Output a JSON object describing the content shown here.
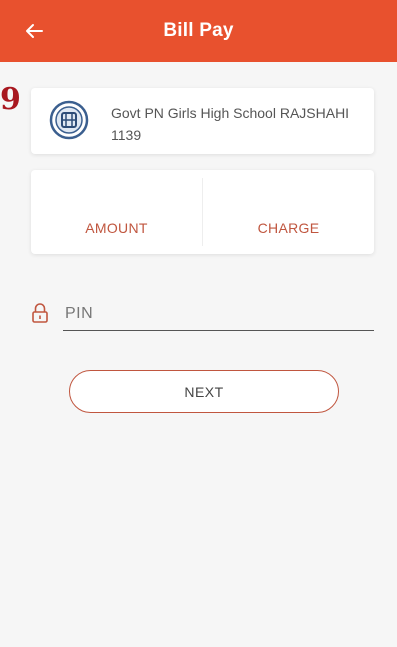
{
  "app_bar": {
    "title": "Bill Pay",
    "color": "#e8512e",
    "back_icon": "arrow-left-icon"
  },
  "corner_mark": "9",
  "school": {
    "name": "Govt PN Girls High School RAJSHAHI",
    "code": "1139",
    "logo_icon": "school-logo-icon"
  },
  "amounts": {
    "amount_label": "AMOUNT",
    "charge_label": "CHARGE",
    "label_color": "#c0563f"
  },
  "pin": {
    "placeholder": "PIN",
    "value": "",
    "icon": "lock-icon"
  },
  "next_button": {
    "label": "NEXT"
  }
}
